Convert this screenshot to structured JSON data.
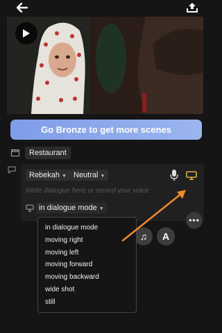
{
  "cta": {
    "label": "Go Bronze to get more scenes"
  },
  "scene": {
    "location": "Restaurant"
  },
  "dialogue": {
    "character": "Rebekah",
    "emotion": "Neutral",
    "placeholder": "Write dialogue here or record your voice",
    "mode": "in dialogue mode"
  },
  "menu": {
    "items": [
      "in dialogue mode",
      "moving right",
      "moving left",
      "moving forward",
      "moving backward",
      "wide shot",
      "still"
    ]
  },
  "colors": {
    "accent": "#f08a2c",
    "cta": "#8aa6ec",
    "shot_icon": "#e8b13a"
  },
  "icons": [
    "back-arrow-icon",
    "export-icon",
    "play-icon",
    "clapperboard-icon",
    "chat-bubble-icon",
    "microphone-icon",
    "camera-shot-icon",
    "more-icon",
    "music-note-icon",
    "text-icon"
  ]
}
